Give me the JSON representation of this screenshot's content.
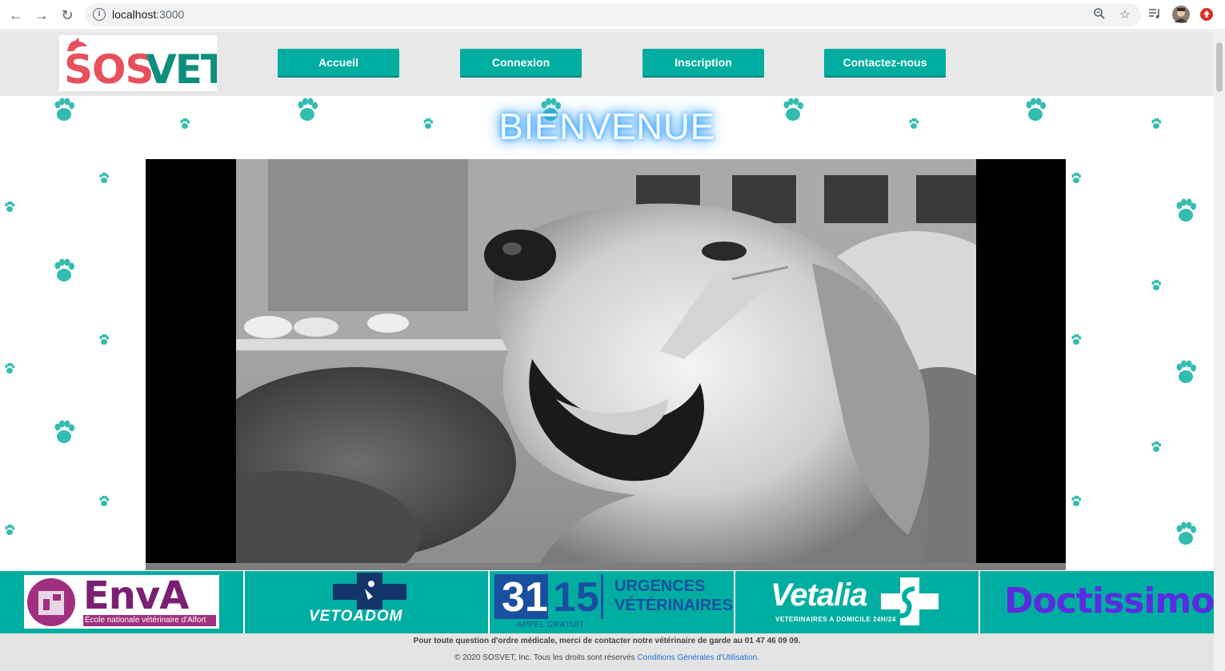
{
  "browser": {
    "url_host": "localhost",
    "url_port": ":3000"
  },
  "site": {
    "logo_left": "SOS",
    "logo_right": "VET",
    "nav": [
      {
        "label": "Accueil"
      },
      {
        "label": "Connexion"
      },
      {
        "label": "Inscription"
      },
      {
        "label": "Contactez-nous"
      }
    ],
    "title": "BIENVENUE"
  },
  "partners": {
    "enva_name": "EnvA",
    "enva_subtitle": "École nationale vétérinaire d'Alfort",
    "vetoadom": "VETOADOM",
    "urgences_number_a": "31",
    "urgences_number_b": "15",
    "urgences_tag": "APPEL GRATUIT",
    "urgences_line1": "URGENCES",
    "urgences_line2": "VÉTÉRINAIRES",
    "vetalia": "Vetalia",
    "vetalia_sub": "VETERINAIRES A DOMICILE 24H/24",
    "doctissimo": "Doctissimo"
  },
  "footer": {
    "line1": "Pour toute question d'ordre médicale, merci de contacter notre vétérinaire de garde au 01 47 46 09 09.",
    "line2_prefix": "© 2020 SOSVET, Inc. Tous les droits sont réservés",
    "cgu_link": "Conditions Générales d'Utilisation."
  },
  "colors": {
    "accent": "#00aea1",
    "logo_red": "#e8505b",
    "logo_green": "#0e8f7e",
    "paw": "#33bcb0"
  }
}
